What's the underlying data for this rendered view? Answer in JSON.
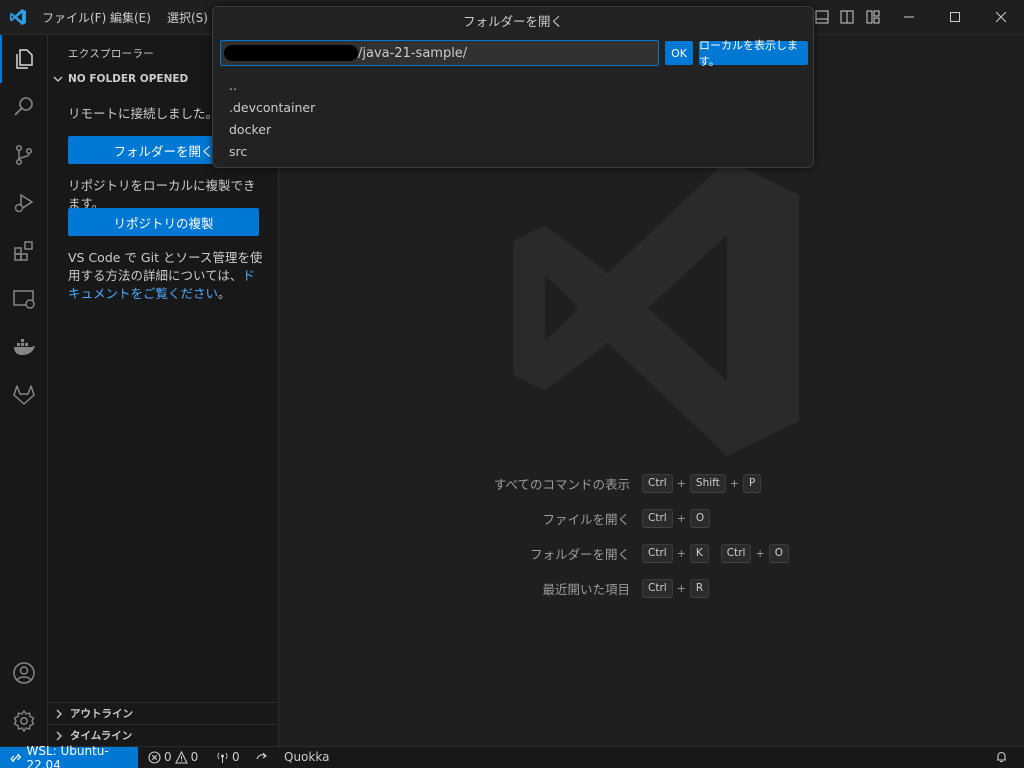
{
  "titlebar": {
    "menus": [
      "ファイル(F)",
      "編集(E)",
      "選択(S)"
    ]
  },
  "quickpick": {
    "title": "フォルダーを開く",
    "input_value": "/java-21-sample/",
    "ok_label": "OK",
    "local_label": "ローカルを表示します。",
    "items": [
      "..",
      ".devcontainer",
      "docker",
      "src"
    ]
  },
  "sidebar": {
    "title": "エクスプローラー",
    "section": "NO FOLDER OPENED",
    "connected_text": "リモートに接続しました。",
    "open_folder_button": "フォルダーを開く",
    "clone_text": "リポジトリをローカルに複製できます。",
    "clone_button": "リポジトリの複製",
    "info_text_prefix": "VS Code で Git とソース管理を使用する方法の詳細については、",
    "info_link": "ドキュメントをご覧ください",
    "info_suffix": "。",
    "outline": "アウトライン",
    "timeline": "タイムライン"
  },
  "editor": {
    "shortcuts": [
      {
        "label": "すべてのコマンドの表示",
        "keys": [
          "Ctrl",
          "Shift",
          "P"
        ]
      },
      {
        "label": "ファイルを開く",
        "keys": [
          "Ctrl",
          "O"
        ]
      },
      {
        "label": "フォルダーを開く",
        "keys": [
          "Ctrl",
          "K"
        ],
        "keys2": [
          "Ctrl",
          "O"
        ]
      },
      {
        "label": "最近開いた項目",
        "keys": [
          "Ctrl",
          "R"
        ]
      }
    ]
  },
  "statusbar": {
    "remote": "WSL: Ubuntu-22.04",
    "errors": "0",
    "warnings": "0",
    "ports": "0",
    "quokka": "Quokka"
  },
  "colors": {
    "accent": "#0078d4",
    "link": "#4daafc",
    "background": "#1f1f1f",
    "sidebar": "#181818"
  },
  "icons": [
    "vscode-logo-icon",
    "explorer-icon",
    "search-icon",
    "source-control-icon",
    "run-debug-icon",
    "extensions-icon",
    "remote-explorer-icon",
    "docker-icon",
    "gitlab-icon",
    "account-icon",
    "settings-gear-icon",
    "bell-icon"
  ]
}
